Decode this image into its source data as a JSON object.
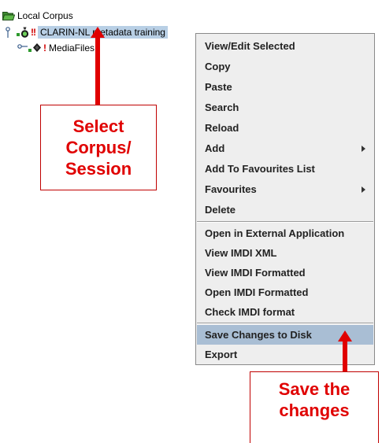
{
  "tree": {
    "root_label": "Local Corpus",
    "corpus_label": "CLARIN-NL metadata training",
    "corpus_flag": "!!",
    "media_label": "MediaFiles",
    "media_flag": "!"
  },
  "context_menu": {
    "items": {
      "view_edit_selected": "View/Edit Selected",
      "copy": "Copy",
      "paste": "Paste",
      "search": "Search",
      "reload": "Reload",
      "add": "Add",
      "add_to_favourites_list": "Add To Favourites List",
      "favourites": "Favourites",
      "delete": "Delete",
      "open_in_external_application": "Open in External Application",
      "view_imdi_xml": "View IMDI XML",
      "view_imdi_formatted": "View IMDI Formatted",
      "open_imdi_formatted": "Open IMDI Formatted",
      "check_imdi_format": "Check IMDI format",
      "save_changes_to_disk": "Save Changes to Disk",
      "export": "Export"
    },
    "highlighted_item": "Save Changes to Disk"
  },
  "annotations": {
    "select_callout": {
      "line1": "Select",
      "line2": "Corpus/",
      "line3": "Session"
    },
    "save_callout": {
      "line1": "Save the",
      "line2": "changes"
    },
    "color": "#e00000"
  },
  "colors": {
    "selection": "#b8cfe5",
    "menu_background": "#eeeeee",
    "menu_highlight": "#a9bed4",
    "warning": "#d00000"
  }
}
